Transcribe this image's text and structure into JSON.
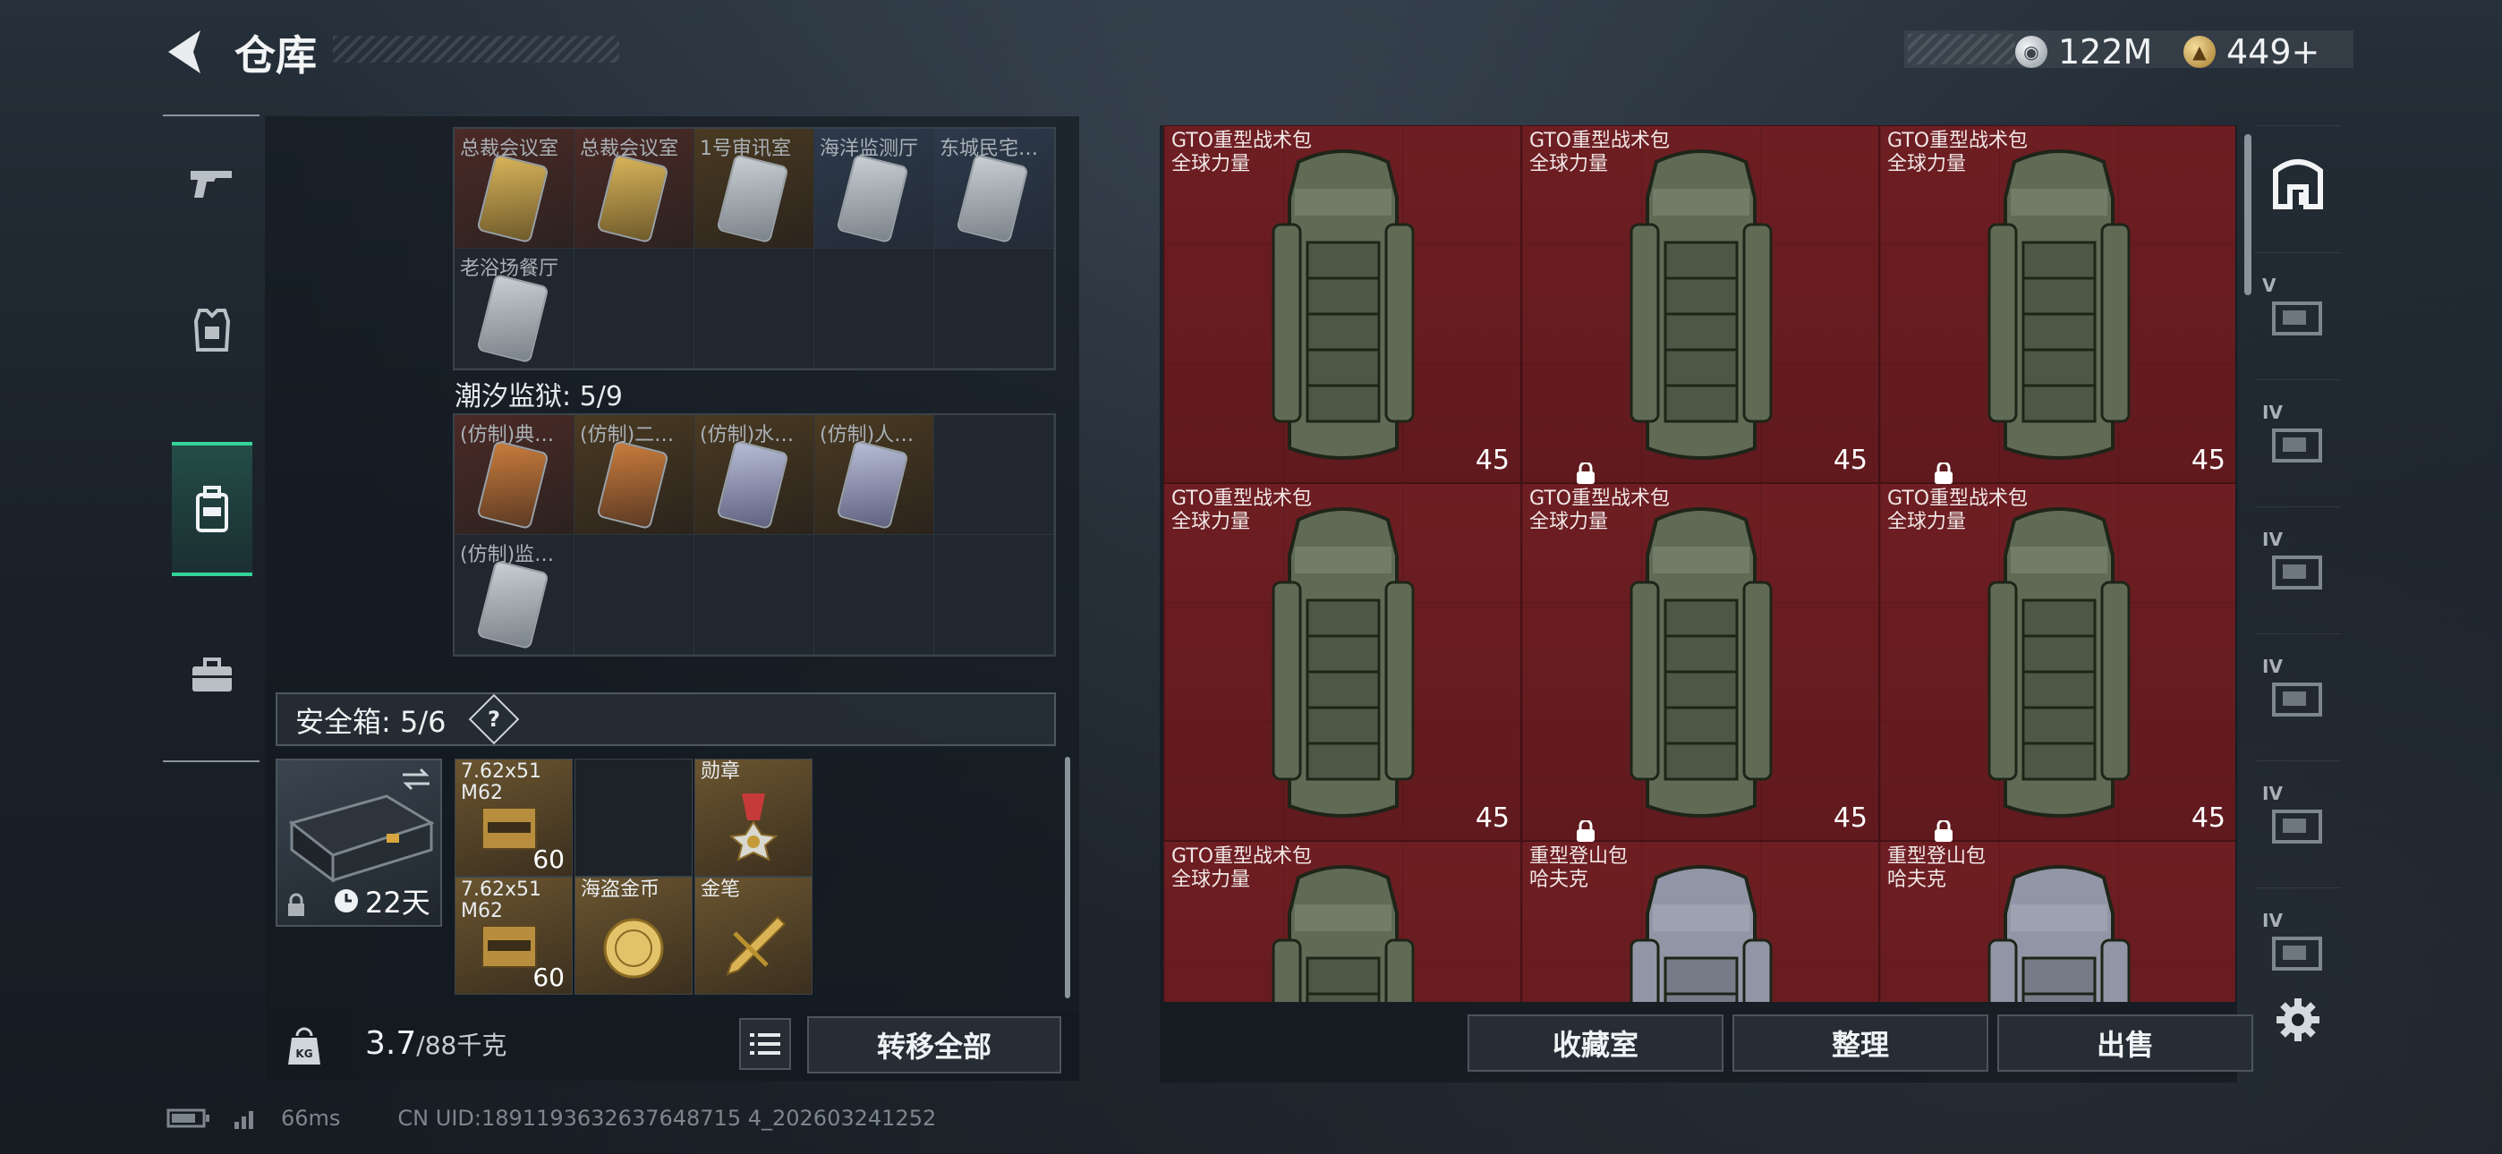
{
  "header": {
    "title": "仓库"
  },
  "currency": {
    "silver": "122M",
    "gold": "449+",
    "silver_icon": "silver-coin-icon",
    "gold_icon": "gold-coin-icon"
  },
  "nav": {
    "items": [
      {
        "icon": "pistol-icon",
        "active": false
      },
      {
        "icon": "armor-vest-icon",
        "active": false
      },
      {
        "icon": "backpack-icon",
        "active": true
      },
      {
        "icon": "briefcase-icon",
        "active": false
      }
    ]
  },
  "keys_group_1": {
    "row1": [
      "总裁会议室",
      "总裁会议室",
      "1号审讯室",
      "海洋监测厅",
      "东城民宅…"
    ],
    "row2": [
      "老浴场餐厅"
    ]
  },
  "prison": {
    "label": "潮汐监狱: 5/9",
    "row1": [
      "(仿制)典…",
      "(仿制)二…",
      "(仿制)水…",
      "(仿制)人…"
    ],
    "row2": [
      "(仿制)监…"
    ]
  },
  "safe_box": {
    "label": "安全箱: 5/6",
    "help": "?",
    "days": "22天",
    "items": [
      {
        "name": "7.62x51 M62",
        "count": "60"
      },
      {
        "name": "",
        "count": ""
      },
      {
        "name": "勋章",
        "count": ""
      },
      {
        "name": "7.62x51 M62",
        "count": "60"
      },
      {
        "name": "海盗金币",
        "count": ""
      },
      {
        "name": "金笔",
        "count": ""
      }
    ]
  },
  "weight": {
    "current": "3.7",
    "max": "/88千克",
    "icon_text": "KG"
  },
  "buttons": {
    "transfer_all": "转移全部",
    "collection": "收藏室",
    "organize": "整理",
    "sell": "出售"
  },
  "stash_items": [
    {
      "name": "GTO重型战术包",
      "sub": "全球力量",
      "capacity": "45",
      "color": "#5f6b55"
    },
    {
      "name": "GTO重型战术包",
      "sub": "全球力量",
      "capacity": "45",
      "color": "#5f6b55"
    },
    {
      "name": "GTO重型战术包",
      "sub": "全球力量",
      "capacity": "45",
      "color": "#5f6b55"
    },
    {
      "name": "GTO重型战术包",
      "sub": "全球力量",
      "capacity": "45",
      "color": "#5f6b55"
    },
    {
      "name": "GTO重型战术包",
      "sub": "全球力量",
      "capacity": "45",
      "color": "#5f6b55"
    },
    {
      "name": "GTO重型战术包",
      "sub": "全球力量",
      "capacity": "45",
      "color": "#5f6b55"
    },
    {
      "name": "GTO重型战术包",
      "sub": "全球力量",
      "capacity": "",
      "color": "#5f6b55"
    },
    {
      "name": "重型登山包",
      "sub": "哈夫克",
      "capacity": "",
      "color": "#9096a6"
    },
    {
      "name": "重型登山包",
      "sub": "哈夫克",
      "capacity": "",
      "color": "#9096a6"
    }
  ],
  "right_sidebar": [
    {
      "icon": "stash-home-icon",
      "tier": ""
    },
    {
      "icon": "tier-v-case-icon",
      "tier": "V"
    },
    {
      "icon": "tier-iv-case-icon",
      "tier": "IV"
    },
    {
      "icon": "tier-iv-case-icon",
      "tier": "IV"
    },
    {
      "icon": "tier-iv-case-icon",
      "tier": "IV"
    },
    {
      "icon": "tier-iv-case-icon",
      "tier": "IV"
    },
    {
      "icon": "tier-iv-case-icon",
      "tier": "IV"
    }
  ],
  "status": {
    "ping": "66ms",
    "uid": "CN UID:1891193632637648715 4_202603241252"
  }
}
